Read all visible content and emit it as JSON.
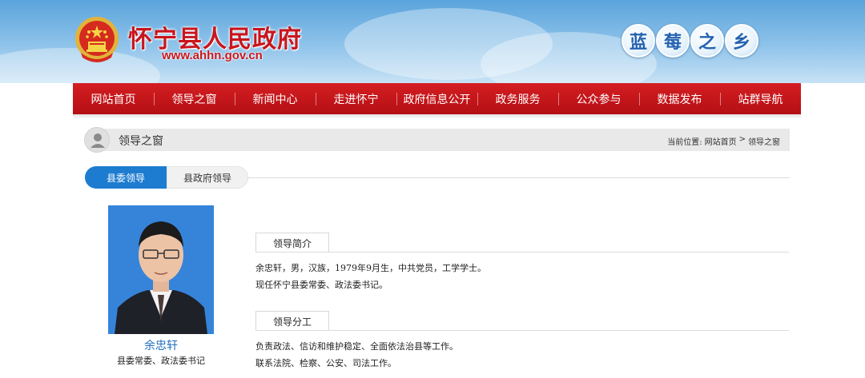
{
  "header": {
    "site_title": "怀宁县人民政府",
    "site_url": "www.ahhn.gov.cn",
    "slogan": [
      "蓝",
      "莓",
      "之",
      "乡"
    ]
  },
  "nav": {
    "items": [
      "网站首页",
      "领导之窗",
      "新闻中心",
      "走进怀宁",
      "政府信息公开",
      "政务服务",
      "公众参与",
      "数据发布",
      "站群导航"
    ]
  },
  "breadcrumb": {
    "section_title": "领导之窗",
    "prefix": "当前位置:",
    "home": "网站首页",
    "separator": ">",
    "current": "领导之窗"
  },
  "tabs": {
    "active": "县委领导",
    "inactive": "县政府领导"
  },
  "leader": {
    "name": "余忠轩",
    "position": "县委常委、政法委书记",
    "intro_heading": "领导简介",
    "intro_lines": [
      "余忠轩，男，汉族，1979年9月生，中共党员，工学学士。",
      "现任怀宁县委常委、政法委书记。"
    ],
    "duty_heading": "领导分工",
    "duty_lines": [
      "负责政法、信访和维护稳定、全面依法治县等工作。",
      "联系法院、检察、公安、司法工作。"
    ]
  },
  "colors": {
    "nav_red": "#c8161d",
    "tab_blue": "#1e7cd0",
    "title_red": "#c8161d",
    "link_blue": "#1e6fc0"
  },
  "icons": {
    "emblem": "national-emblem-icon",
    "user": "user-icon"
  }
}
